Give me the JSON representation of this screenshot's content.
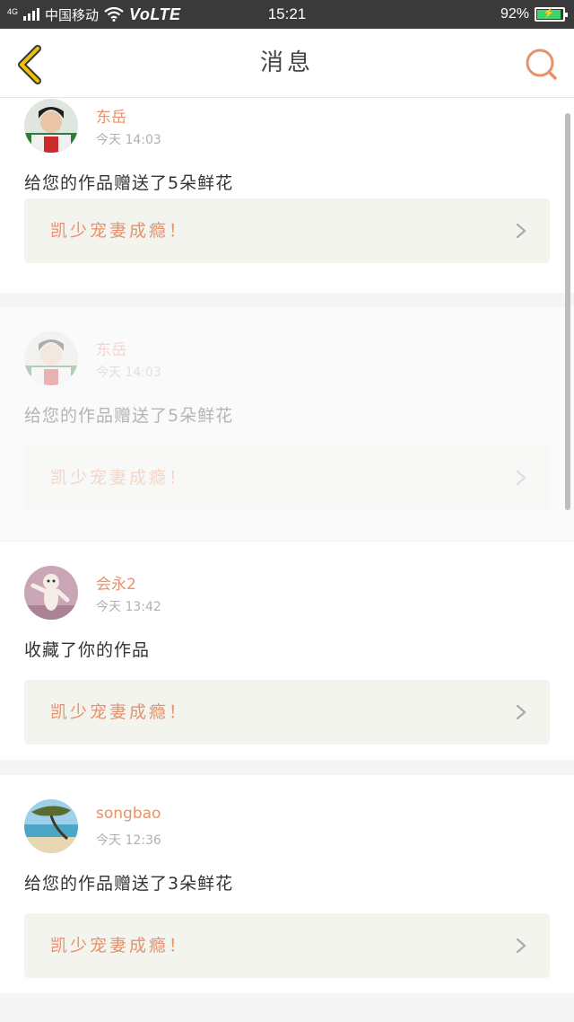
{
  "status_bar": {
    "network": "4G",
    "carrier": "中国移动",
    "volte": "VoLTE",
    "time": "15:21",
    "battery_percent": "92%",
    "battery_level": 0.92
  },
  "header": {
    "title": "消息"
  },
  "colors": {
    "accent": "#e8916a",
    "back_arrow": "#f2c200",
    "status_bar": "#3a3a3a"
  },
  "messages": [
    {
      "username": "东岳",
      "time": "今天 14:03",
      "text": "给您的作品赠送了5朵鲜花",
      "work_title": "凯少宠妻成瘾！"
    },
    {
      "username": "东岳",
      "time": "今天 14:03",
      "text": "给您的作品赠送了5朵鲜花",
      "work_title": "凯少宠妻成瘾！"
    },
    {
      "username": "会永2",
      "time": "今天 13:42",
      "text": "收藏了你的作品",
      "work_title": "凯少宠妻成瘾！"
    },
    {
      "username": "songbao",
      "time": "今天 12:36",
      "text": "给您的作品赠送了3朵鲜花",
      "work_title": "凯少宠妻成瘾！"
    }
  ]
}
